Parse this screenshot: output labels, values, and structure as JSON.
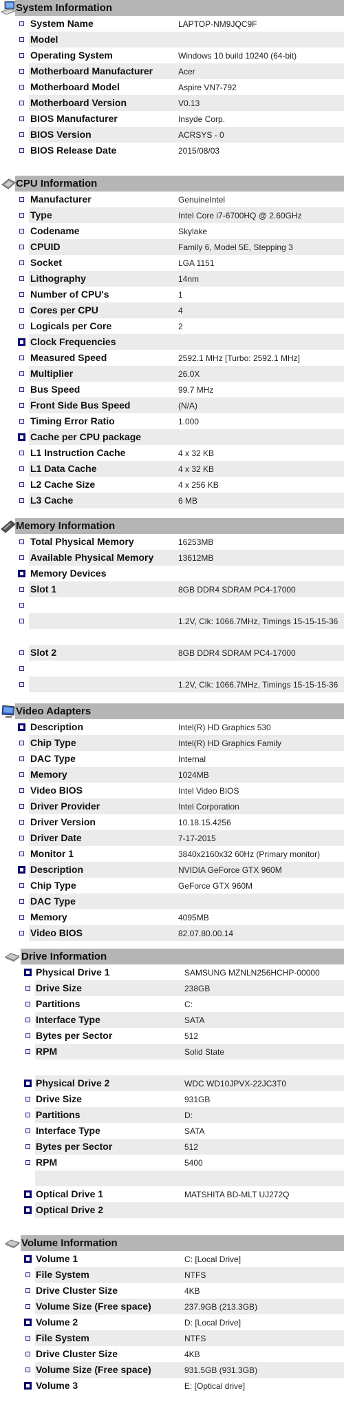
{
  "colors": {
    "header_bar": "#b5b5b5",
    "stripe": "#ebebeb",
    "bullet": "#0a0a72"
  },
  "sections": [
    {
      "title": "System Information",
      "icon": "computer-icon",
      "rows": [
        {
          "label": "System Name",
          "value": "LAPTOP-NM9JQC9F",
          "bullet": "small"
        },
        {
          "label": "Model",
          "value": "",
          "bullet": "small"
        },
        {
          "label": "Operating System",
          "value": "Windows 10 build 10240 (64-bit)",
          "bullet": "small"
        },
        {
          "label": "Motherboard Manufacturer",
          "value": "Acer",
          "bullet": "small"
        },
        {
          "label": "Motherboard Model",
          "value": "Aspire VN7-792",
          "bullet": "small"
        },
        {
          "label": "Motherboard Version",
          "value": "V0.13",
          "bullet": "small"
        },
        {
          "label": "BIOS Manufacturer",
          "value": "Insyde Corp.",
          "bullet": "small"
        },
        {
          "label": "BIOS Version",
          "value": "ACRSYS - 0",
          "bullet": "small"
        },
        {
          "label": "BIOS Release Date",
          "value": "2015/08/03",
          "bullet": "small"
        }
      ]
    },
    {
      "title": "CPU Information",
      "icon": "cpu-chip-icon",
      "rows": [
        {
          "label": "Manufacturer",
          "value": "GenuineIntel",
          "bullet": "small"
        },
        {
          "label": "Type",
          "value": "Intel Core i7-6700HQ @ 2.60GHz",
          "bullet": "small"
        },
        {
          "label": "Codename",
          "value": "Skylake",
          "bullet": "small"
        },
        {
          "label": "CPUID",
          "value": "Family 6, Model 5E, Stepping 3",
          "bullet": "small"
        },
        {
          "label": "Socket",
          "value": "LGA 1151",
          "bullet": "small"
        },
        {
          "label": "Lithography",
          "value": "14nm",
          "bullet": "small"
        },
        {
          "label": "Number of CPU's",
          "value": "1",
          "bullet": "small"
        },
        {
          "label": "Cores per CPU",
          "value": "4",
          "bullet": "small"
        },
        {
          "label": "Logicals per Core",
          "value": "2",
          "bullet": "small"
        },
        {
          "label": "Clock Frequencies",
          "value": "",
          "bullet": "large"
        },
        {
          "label": "Measured Speed",
          "value": "2592.1 MHz [Turbo: 2592.1 MHz]",
          "bullet": "small"
        },
        {
          "label": "Multiplier",
          "value": "26.0X",
          "bullet": "small"
        },
        {
          "label": "Bus Speed",
          "value": "99.7 MHz",
          "bullet": "small"
        },
        {
          "label": "Front Side Bus Speed",
          "value": "(N/A)",
          "bullet": "small"
        },
        {
          "label": "Timing Error Ratio",
          "value": "1.000",
          "bullet": "small"
        },
        {
          "label": "Cache per CPU package",
          "value": "",
          "bullet": "large"
        },
        {
          "label": "L1 Instruction Cache",
          "value": "4 x 32 KB",
          "bullet": "small"
        },
        {
          "label": "L1 Data Cache",
          "value": "4 x 32 KB",
          "bullet": "small"
        },
        {
          "label": "L2 Cache Size",
          "value": "4 x 256 KB",
          "bullet": "small"
        },
        {
          "label": "L3 Cache",
          "value": "6 MB",
          "bullet": "small"
        }
      ]
    },
    {
      "title": "Memory Information",
      "icon": "memory-module-icon",
      "rows": [
        {
          "label": "Total Physical Memory",
          "value": "16253MB",
          "bullet": "small"
        },
        {
          "label": "Available Physical Memory",
          "value": "13612MB",
          "bullet": "small"
        },
        {
          "label": "Memory Devices",
          "value": "",
          "bullet": "large"
        },
        {
          "label": "Slot 1",
          "value": "8GB DDR4 SDRAM PC4-17000",
          "bullet": "small"
        },
        {
          "label": "",
          "value": "",
          "bullet": "small"
        },
        {
          "label": "",
          "value": "1.2V, Clk: 1066.7MHz, Timings 15-15-15-36",
          "bullet": "small"
        },
        {
          "label": "",
          "value": "",
          "bullet": "none"
        },
        {
          "label": "Slot 2",
          "value": "8GB DDR4 SDRAM PC4-17000",
          "bullet": "small"
        },
        {
          "label": "",
          "value": "",
          "bullet": "small"
        },
        {
          "label": "",
          "value": "1.2V, Clk: 1066.7MHz, Timings 15-15-15-36",
          "bullet": "small"
        }
      ]
    },
    {
      "title": "Video Adapters",
      "icon": "monitor-icon",
      "rows": [
        {
          "label": "Description",
          "value": "Intel(R) HD Graphics 530",
          "bullet": "large"
        },
        {
          "label": "Chip Type",
          "value": "Intel(R) HD Graphics Family",
          "bullet": "small"
        },
        {
          "label": "DAC Type",
          "value": "Internal",
          "bullet": "small"
        },
        {
          "label": "Memory",
          "value": "1024MB",
          "bullet": "small"
        },
        {
          "label": "Video BIOS",
          "value": "Intel Video BIOS",
          "bullet": "small"
        },
        {
          "label": "Driver Provider",
          "value": "Intel Corporation",
          "bullet": "small"
        },
        {
          "label": "Driver Version",
          "value": "10.18.15.4256",
          "bullet": "small"
        },
        {
          "label": "Driver Date",
          "value": "7-17-2015",
          "bullet": "small"
        },
        {
          "label": "Monitor 1",
          "value": "3840x2160x32 60Hz (Primary monitor)",
          "bullet": "small"
        },
        {
          "label": "Description",
          "value": "NVIDIA GeForce GTX 960M",
          "bullet": "large"
        },
        {
          "label": "Chip Type",
          "value": "GeForce GTX 960M",
          "bullet": "small"
        },
        {
          "label": "DAC Type",
          "value": "",
          "bullet": "small"
        },
        {
          "label": "Memory",
          "value": "4095MB",
          "bullet": "small"
        },
        {
          "label": "Video BIOS",
          "value": "82.07.80.00.14",
          "bullet": "small"
        }
      ]
    },
    {
      "title": "Drive Information",
      "icon": "hard-drive-icon",
      "rows": [
        {
          "label": "Physical Drive 1",
          "value": "SAMSUNG MZNLN256HCHP-00000",
          "bullet": "large"
        },
        {
          "label": "Drive Size",
          "value": "238GB",
          "bullet": "small"
        },
        {
          "label": "Partitions",
          "value": "C:",
          "bullet": "small"
        },
        {
          "label": "Interface Type",
          "value": "SATA",
          "bullet": "small"
        },
        {
          "label": "Bytes per Sector",
          "value": "512",
          "bullet": "small"
        },
        {
          "label": "RPM",
          "value": "Solid State",
          "bullet": "small"
        },
        {
          "label": "",
          "value": "",
          "bullet": "none"
        },
        {
          "label": "Physical Drive 2",
          "value": "WDC WD10JPVX-22JC3T0",
          "bullet": "large"
        },
        {
          "label": "Drive Size",
          "value": "931GB",
          "bullet": "small"
        },
        {
          "label": "Partitions",
          "value": "D:",
          "bullet": "small"
        },
        {
          "label": "Interface Type",
          "value": "SATA",
          "bullet": "small"
        },
        {
          "label": "Bytes per Sector",
          "value": "512",
          "bullet": "small"
        },
        {
          "label": "RPM",
          "value": "5400",
          "bullet": "small"
        },
        {
          "label": "",
          "value": "",
          "bullet": "none"
        },
        {
          "label": "Optical Drive 1",
          "value": "MATSHITA BD-MLT UJ272Q",
          "bullet": "large"
        },
        {
          "label": "Optical Drive 2",
          "value": "",
          "bullet": "large"
        }
      ]
    },
    {
      "title": "Volume Information",
      "icon": "hard-drive-icon",
      "rows": [
        {
          "label": "Volume 1",
          "value": "C:  [Local Drive]",
          "bullet": "large"
        },
        {
          "label": "File System",
          "value": "NTFS",
          "bullet": "small"
        },
        {
          "label": "Drive Cluster Size",
          "value": "4KB",
          "bullet": "small"
        },
        {
          "label": "Volume Size (Free space)",
          "value": "237.9GB (213.3GB)",
          "bullet": "small"
        },
        {
          "label": "Volume 2",
          "value": "D:  [Local Drive]",
          "bullet": "large"
        },
        {
          "label": "File System",
          "value": "NTFS",
          "bullet": "small"
        },
        {
          "label": "Drive Cluster Size",
          "value": "4KB",
          "bullet": "small"
        },
        {
          "label": "Volume Size (Free space)",
          "value": "931.5GB (931.3GB)",
          "bullet": "small"
        },
        {
          "label": "Volume 3",
          "value": "E:  [Optical drive]",
          "bullet": "large"
        }
      ]
    }
  ]
}
